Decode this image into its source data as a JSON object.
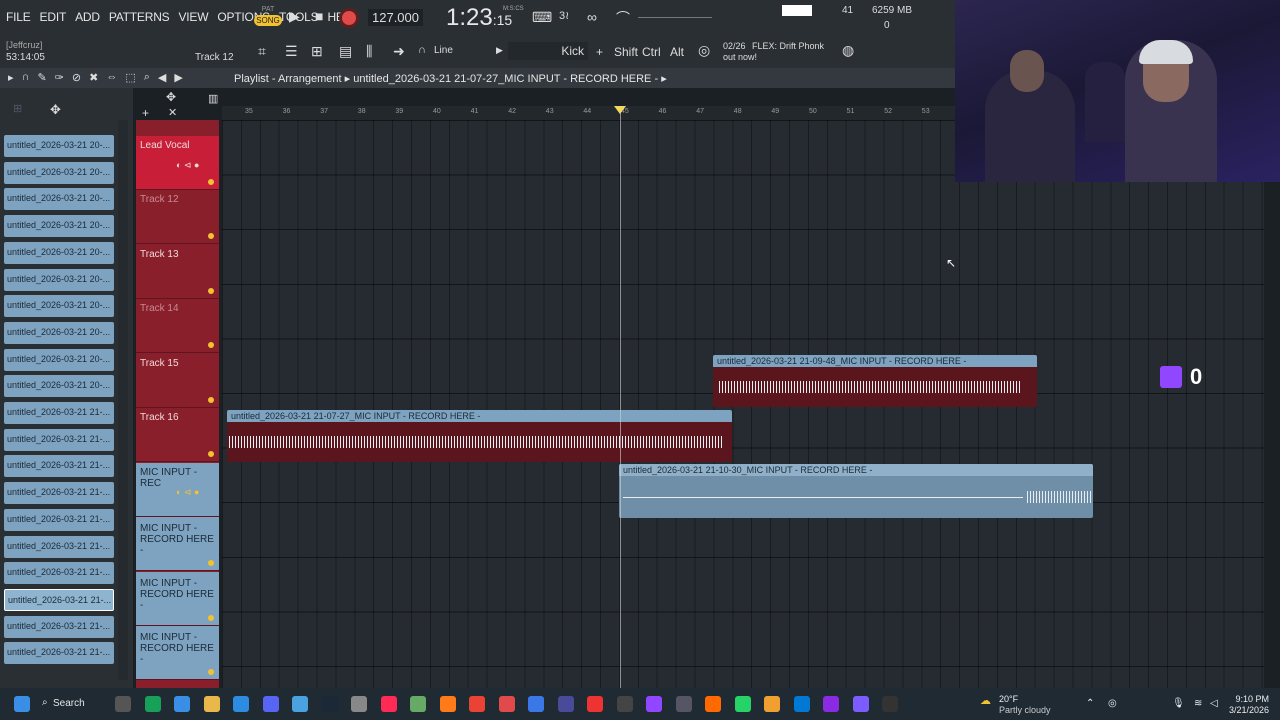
{
  "menu": [
    "FILE",
    "EDIT",
    "ADD",
    "PATTERNS",
    "VIEW",
    "OPTIONS",
    "TOOLS",
    "HELP"
  ],
  "transport": {
    "pat": "PAT",
    "song": "SONG",
    "tempo": "127.000",
    "time_main": "1:23",
    "time_sub": ":15",
    "time_unit": "M:S:CS"
  },
  "meters": {
    "cpu": "41",
    "memory": "6259 MB",
    "polyphony": "0"
  },
  "user": {
    "handle": "[Jeffcruz]",
    "clock": "53:14:05"
  },
  "toolbar": {
    "track_hint": "Track 12",
    "snap": "Line",
    "channel": "Kick",
    "mod_shift": "Shift",
    "mod_ctrl": "Ctrl",
    "mod_alt": "Alt"
  },
  "news": {
    "date": "02/26",
    "line1": "FLEX: Drift Phonk",
    "line2": "out now!"
  },
  "playlist": {
    "title": "Playlist - Arrangement",
    "breadcrumb": "untitled_2026-03-21 21-07-27_MIC INPUT - RECORD HERE -"
  },
  "ruler_ticks": [
    "35",
    "36",
    "37",
    "38",
    "39",
    "40",
    "41",
    "42",
    "43",
    "44",
    "45",
    "46",
    "47",
    "48",
    "49",
    "50",
    "51",
    "52",
    "53"
  ],
  "browser_clips": [
    "untitled_2026-03-21 20-...",
    "untitled_2026-03-21 20-...",
    "untitled_2026-03-21 20-...",
    "untitled_2026-03-21 20-...",
    "untitled_2026-03-21 20-...",
    "untitled_2026-03-21 20-...",
    "untitled_2026-03-21 20-...",
    "untitled_2026-03-21 20-...",
    "untitled_2026-03-21 20-...",
    "untitled_2026-03-21 20-...",
    "untitled_2026-03-21 21-...",
    "untitled_2026-03-21 21-...",
    "untitled_2026-03-21 21-...",
    "untitled_2026-03-21 21-...",
    "untitled_2026-03-21 21-...",
    "untitled_2026-03-21 21-...",
    "untitled_2026-03-21 21-...",
    "untitled_2026-03-21 21-...",
    "untitled_2026-03-21 21-...",
    "untitled_2026-03-21 21-..."
  ],
  "tracks": {
    "lead": "Lead Vocal",
    "t12": "Track 12",
    "t13": "Track 13",
    "t14": "Track 14",
    "t15": "Track 15",
    "t16": "Track 16",
    "mic": "MIC INPUT - REC",
    "mic2": "MIC INPUT - RECORD HERE -",
    "mic3": "MIC INPUT - RECORD HERE -",
    "mic4": "MIC INPUT - RECORD HERE -"
  },
  "clips": {
    "c1": "untitled_2026-03-21 21-09-48_MIC INPUT - RECORD HERE -",
    "c2": "untitled_2026-03-21 21-07-27_MIC INPUT - RECORD HERE -",
    "c3": "untitled_2026-03-21 21-10-30_MIC INPUT - RECORD HERE -"
  },
  "twitch": {
    "count": "0"
  },
  "taskbar": {
    "search": "Search",
    "temp": "20°F",
    "weather": "Partly cloudy",
    "time": "9:10 PM",
    "date": "3/21/2026"
  }
}
